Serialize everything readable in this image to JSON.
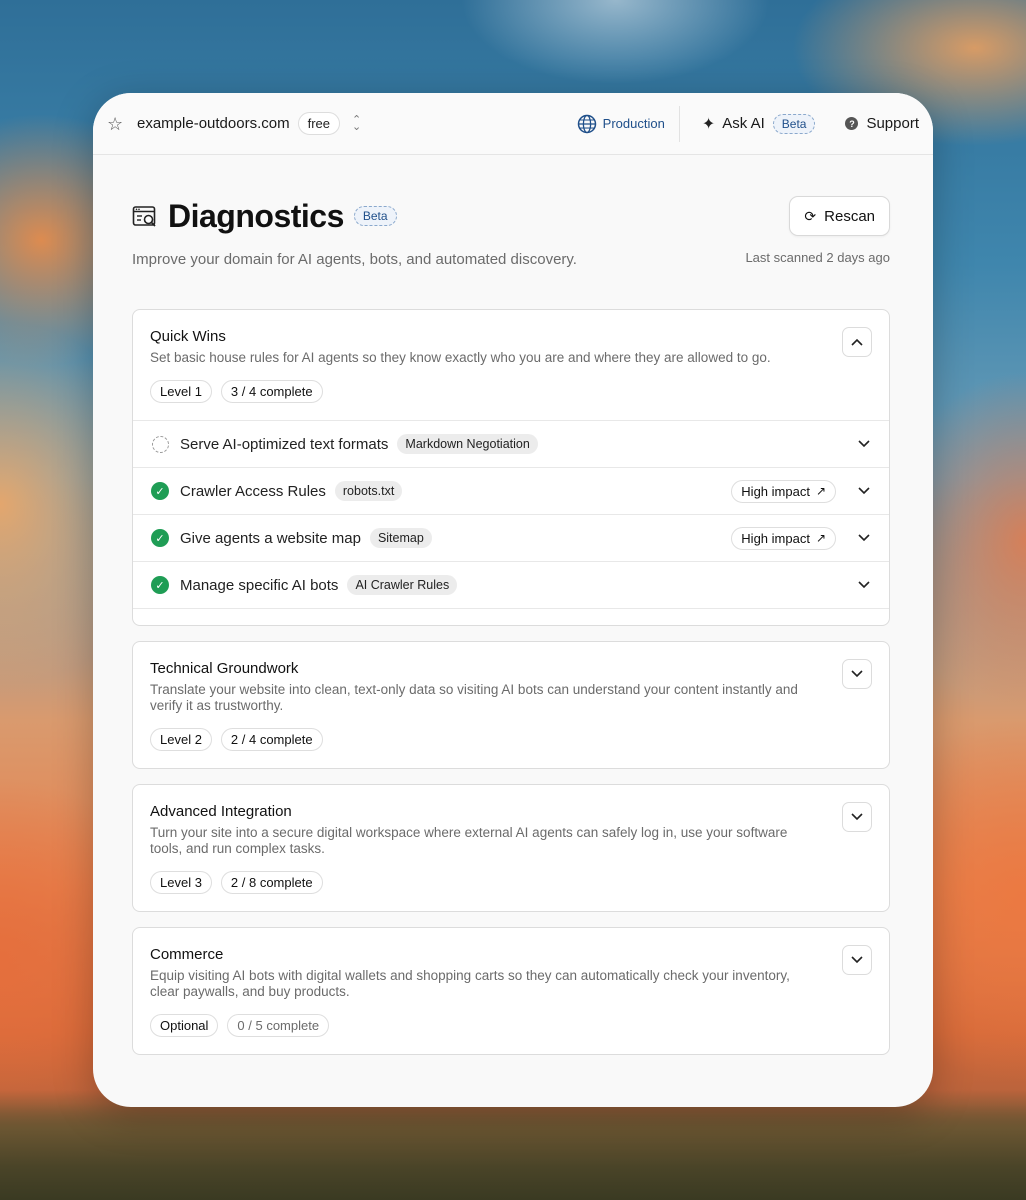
{
  "topbar": {
    "domain": "example-outdoors.com",
    "plan": "free",
    "environment": "Production",
    "ask_ai_label": "Ask AI",
    "ask_ai_badge": "Beta",
    "support_label": "Support"
  },
  "page": {
    "title": "Diagnostics",
    "title_badge": "Beta",
    "subtitle": "Improve your domain for AI agents, bots, and automated discovery.",
    "rescan_label": "Rescan",
    "last_scanned": "Last scanned 2 days ago"
  },
  "sections": [
    {
      "title": "Quick Wins",
      "description": "Set basic house rules for AI agents so they know exactly who you are and where they are allowed to go.",
      "level": "Level 1",
      "progress": "3 / 4 complete",
      "expanded": true,
      "items": [
        {
          "label": "Serve AI-optimized text formats",
          "tag": "Markdown Negotiation",
          "status": "pending",
          "impact": ""
        },
        {
          "label": "Crawler Access Rules",
          "tag": "robots.txt",
          "status": "complete",
          "impact": "High impact"
        },
        {
          "label": "Give agents a website map",
          "tag": "Sitemap",
          "status": "complete",
          "impact": "High impact"
        },
        {
          "label": "Manage specific AI bots",
          "tag": "AI Crawler Rules",
          "status": "complete",
          "impact": ""
        }
      ]
    },
    {
      "title": "Technical Groundwork",
      "description": "Translate your website into clean, text-only data so visiting AI bots can understand your content instantly and verify it as trustworthy.",
      "level": "Level 2",
      "progress": "2 / 4 complete",
      "expanded": false
    },
    {
      "title": "Advanced Integration",
      "description": "Turn your site into a secure digital workspace where external AI agents can safely log in, use your software tools, and run complex tasks.",
      "level": "Level 3",
      "progress": "2 / 8 complete",
      "expanded": false
    },
    {
      "title": "Commerce",
      "description": "Equip visiting AI bots with digital wallets and shopping carts so they can automatically check your inventory, clear paywalls, and buy products.",
      "level": "Optional",
      "progress": "0 / 5 complete",
      "expanded": false
    }
  ],
  "colors": {
    "success": "#1f9d55",
    "accent": "#1f4f8a"
  }
}
